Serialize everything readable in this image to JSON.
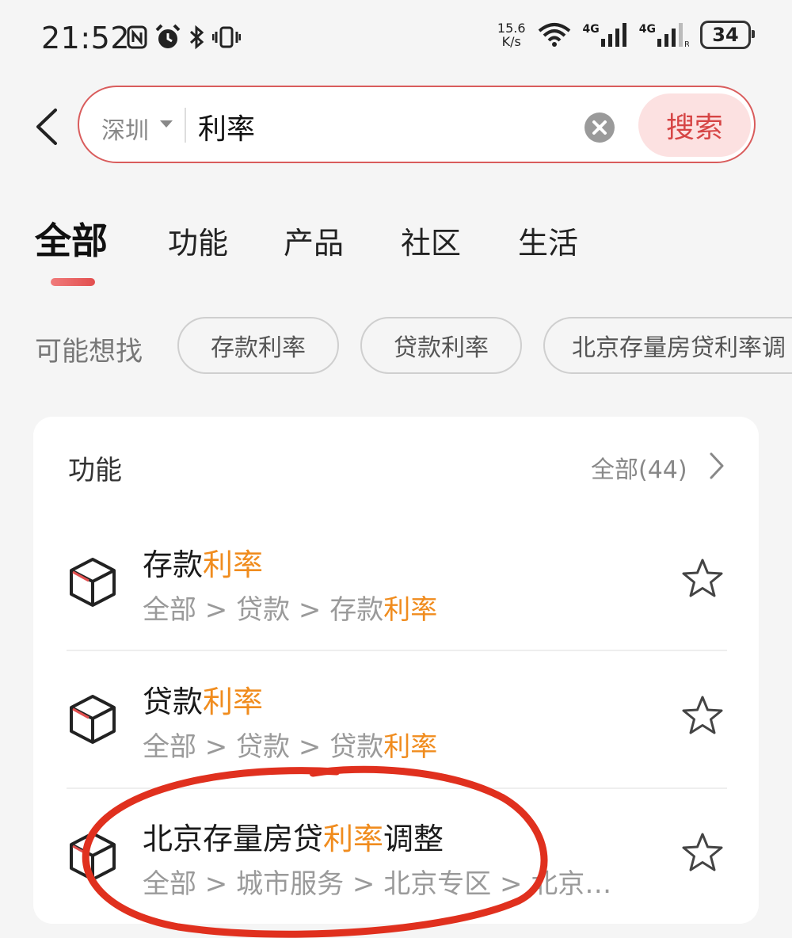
{
  "status_bar": {
    "time": "21:52",
    "net_speed_value": "15.6",
    "net_speed_unit": "K/s",
    "network_1": "4G",
    "network_2": "4G",
    "battery": "34"
  },
  "search": {
    "city": "深圳",
    "query": "利率",
    "button_label": "搜索"
  },
  "tabs": [
    {
      "label": "全部",
      "active": true
    },
    {
      "label": "功能"
    },
    {
      "label": "产品"
    },
    {
      "label": "社区"
    },
    {
      "label": "生活"
    }
  ],
  "suggestions": {
    "label": "可能想找",
    "chips": [
      "存款利率",
      "贷款利率",
      "北京存量房贷利率调"
    ]
  },
  "section": {
    "title": "功能",
    "all_link": "全部(44)"
  },
  "results": [
    {
      "title_pre": "存款",
      "title_hl": "利率",
      "title_post": "",
      "path_pre": "全部 > 贷款 > 存款",
      "path_hl": "利率",
      "path_post": ""
    },
    {
      "title_pre": "贷款",
      "title_hl": "利率",
      "title_post": "",
      "path_pre": "全部 > 贷款 > 贷款",
      "path_hl": "利率",
      "path_post": ""
    },
    {
      "title_pre": "北京存量房贷",
      "title_hl": "利率",
      "title_post": "调整",
      "path_pre": "全部 > 城市服务 > 北京专区 > 北京…",
      "path_hl": "",
      "path_post": ""
    }
  ],
  "colors": {
    "accent_red": "#d64545",
    "highlight_orange": "#f08c1e",
    "annotation_red": "#e0301e"
  }
}
